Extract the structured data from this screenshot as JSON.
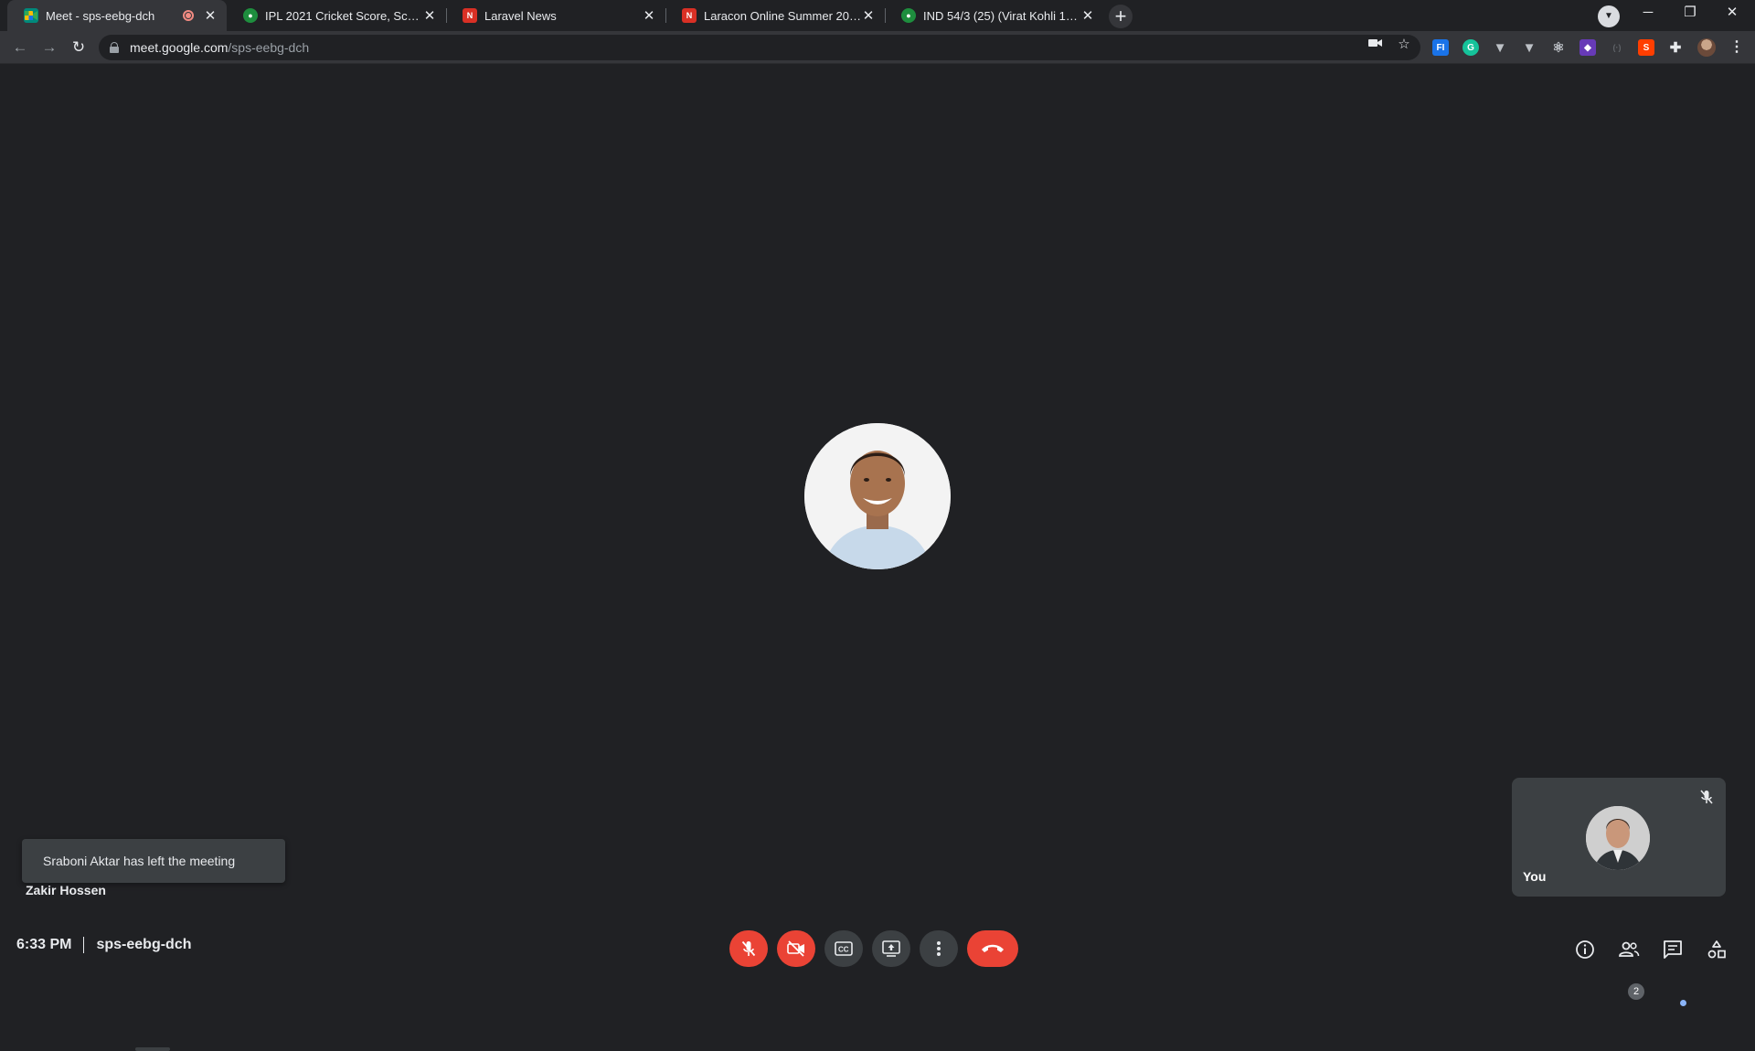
{
  "browser": {
    "tabs": [
      {
        "title": "Meet - sps-eebg-dch",
        "active": true,
        "recording": true,
        "favicon": "google-meet-icon",
        "favicon_color": "#00897b"
      },
      {
        "title": "IPL 2021 Cricket Score, Schedule,",
        "active": false,
        "favicon": "cricket-icon",
        "favicon_color": "#1e8e3e"
      },
      {
        "title": "Laravel News",
        "active": false,
        "favicon": "laravel-news-icon",
        "favicon_color": "#d93025"
      },
      {
        "title": "Laracon Online Summer 2021 | L",
        "active": false,
        "favicon": "laravel-news-icon",
        "favicon_color": "#d93025"
      },
      {
        "title": "IND 54/3 (25) (Virat Kohli 18(29)",
        "active": false,
        "favicon": "cricket-icon",
        "favicon_color": "#1e8e3e"
      }
    ],
    "address": {
      "host": "meet.google.com",
      "path": "/sps-eebg-dch"
    }
  },
  "meeting": {
    "code": "sps-eebg-dch",
    "time": "6:33 PM",
    "presenter_name": "Zakir Hossen",
    "toast": "Sraboni Aktar has left the meeting",
    "self_label": "You",
    "participant_count": "2"
  },
  "colors": {
    "accent_red": "#ea4335",
    "control_gray": "#3c4043",
    "background": "#202124"
  }
}
